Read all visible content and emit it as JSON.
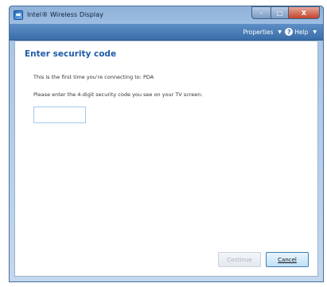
{
  "window": {
    "title": "Intel® Wireless Display",
    "controls": {
      "minimize": "–",
      "maximize": "□",
      "close": "X"
    }
  },
  "menubar": {
    "properties_label": "Properties",
    "help_label": "Help"
  },
  "main": {
    "heading": "Enter security code",
    "first_time_text": "This is the first time you're connecting to: PDA",
    "instruction_text": "Please enter the 4-digit security code you see on your TV screen:",
    "code_input_value": ""
  },
  "buttons": {
    "continue_label": "Continue",
    "cancel_label": "Cancel"
  },
  "colors": {
    "heading_blue": "#1e5aa8",
    "menubar_blue": "#3a6ea9",
    "close_red": "#c5432b"
  }
}
